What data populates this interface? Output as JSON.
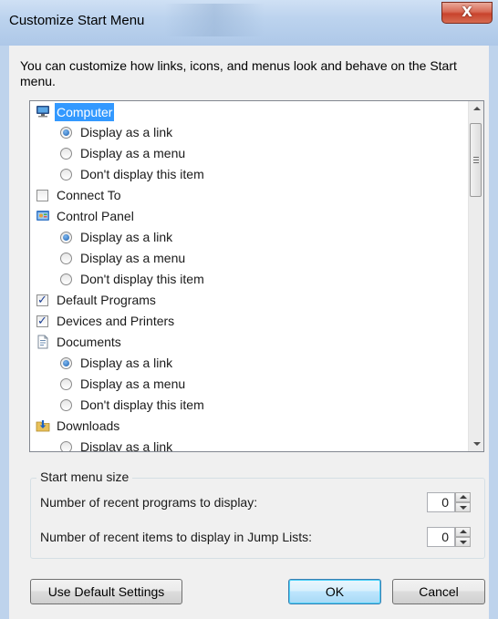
{
  "window": {
    "title": "Customize Start Menu",
    "close_glyph": "X"
  },
  "description": "You can customize how links, icons, and menus look and behave on the Start menu.",
  "list_items": [
    {
      "type": "item",
      "icon": "computer-icon",
      "label": "Computer",
      "selected": true
    },
    {
      "type": "radio",
      "label": "Display as a link",
      "checked": true
    },
    {
      "type": "radio",
      "label": "Display as a menu",
      "checked": false
    },
    {
      "type": "radio",
      "label": "Don't display this item",
      "checked": false
    },
    {
      "type": "checkbox",
      "label": "Connect To",
      "checked": false
    },
    {
      "type": "item",
      "icon": "control-panel-icon",
      "label": "Control Panel"
    },
    {
      "type": "radio",
      "label": "Display as a link",
      "checked": true
    },
    {
      "type": "radio",
      "label": "Display as a menu",
      "checked": false
    },
    {
      "type": "radio",
      "label": "Don't display this item",
      "checked": false
    },
    {
      "type": "checkbox",
      "label": "Default Programs",
      "checked": true
    },
    {
      "type": "checkbox",
      "label": "Devices and Printers",
      "checked": true
    },
    {
      "type": "item",
      "icon": "documents-icon",
      "label": "Documents"
    },
    {
      "type": "radio",
      "label": "Display as a link",
      "checked": true
    },
    {
      "type": "radio",
      "label": "Display as a menu",
      "checked": false
    },
    {
      "type": "radio",
      "label": "Don't display this item",
      "checked": false
    },
    {
      "type": "item",
      "icon": "downloads-icon",
      "label": "Downloads"
    },
    {
      "type": "radio",
      "label": "Display as a link",
      "checked": false
    }
  ],
  "start_menu_size": {
    "group_title": "Start menu size",
    "recent_programs_label": "Number of recent programs to display:",
    "recent_programs_value": "0",
    "recent_items_label": "Number of recent items to display in Jump Lists:",
    "recent_items_value": "0"
  },
  "buttons": {
    "defaults": "Use Default Settings",
    "ok": "OK",
    "cancel": "Cancel"
  }
}
